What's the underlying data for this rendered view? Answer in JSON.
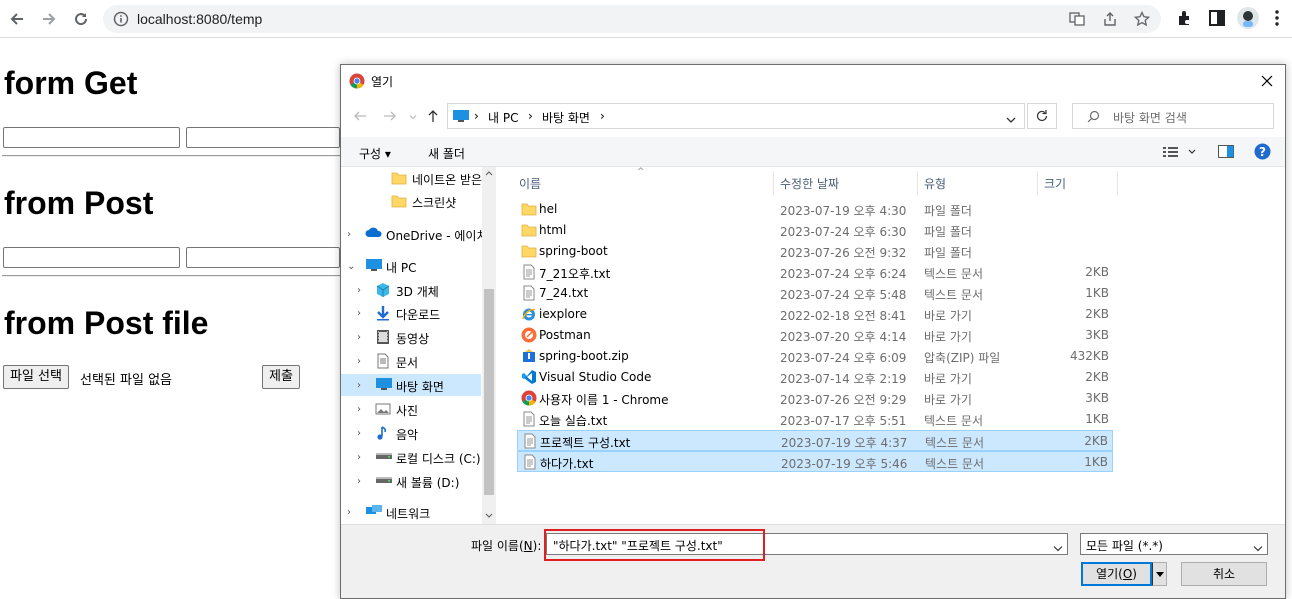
{
  "browser": {
    "url": "localhost:8080/temp"
  },
  "page": {
    "sections": [
      {
        "title": "form Get"
      },
      {
        "title": "from Post"
      },
      {
        "title": "from Post file"
      }
    ],
    "file_button": "파일 선택",
    "file_status": "선택된 파일 없음",
    "submit_button": "제출"
  },
  "dialog": {
    "title": "열기",
    "breadcrumb": [
      "내 PC",
      "바탕 화면"
    ],
    "search_placeholder": "바탕 화면 검색",
    "organize_label": "구성",
    "new_folder_label": "새 폴더",
    "nav_items": [
      {
        "label": "네이트온 받은 파",
        "icon": "folder-icon",
        "indent": 2
      },
      {
        "label": "스크린샷",
        "icon": "folder-icon",
        "indent": 2
      },
      {
        "label": "OneDrive - 에이치",
        "icon": "cloud-icon",
        "indent": 0
      },
      {
        "label": "내 PC",
        "icon": "pc-icon",
        "indent": 0
      },
      {
        "label": "3D 개체",
        "icon": "cube-icon",
        "indent": 1
      },
      {
        "label": "다운로드",
        "icon": "download-icon",
        "indent": 1
      },
      {
        "label": "동영상",
        "icon": "video-icon",
        "indent": 1
      },
      {
        "label": "문서",
        "icon": "document-icon",
        "indent": 1
      },
      {
        "label": "바탕 화면",
        "icon": "desktop-icon",
        "indent": 1
      },
      {
        "label": "사진",
        "icon": "picture-icon",
        "indent": 1
      },
      {
        "label": "음악",
        "icon": "music-icon",
        "indent": 1
      },
      {
        "label": "로컬 디스크 (C:)",
        "icon": "drive-icon",
        "indent": 1
      },
      {
        "label": "새 볼륨 (D:)",
        "icon": "drive-icon",
        "indent": 1
      },
      {
        "label": "네트워크",
        "icon": "network-icon",
        "indent": 0
      }
    ],
    "selected_nav": "바탕 화면",
    "columns": {
      "name": "이름",
      "date": "수정한 날짜",
      "type": "유형",
      "size": "크기"
    },
    "files": [
      {
        "name": "hel",
        "date": "2023-07-19 오후 4:30",
        "type": "파일 폴더",
        "size": "",
        "icon": "folder-icon",
        "selected": false
      },
      {
        "name": "html",
        "date": "2023-07-24 오후 6:30",
        "type": "파일 폴더",
        "size": "",
        "icon": "folder-icon",
        "selected": false
      },
      {
        "name": "spring-boot",
        "date": "2023-07-26 오전 9:32",
        "type": "파일 폴더",
        "size": "",
        "icon": "folder-icon",
        "selected": false
      },
      {
        "name": "7_21오후.txt",
        "date": "2023-07-24 오후 6:24",
        "type": "텍스트 문서",
        "size": "2KB",
        "icon": "text-file-icon",
        "selected": false
      },
      {
        "name": "7_24.txt",
        "date": "2023-07-24 오후 5:48",
        "type": "텍스트 문서",
        "size": "1KB",
        "icon": "text-file-icon",
        "selected": false
      },
      {
        "name": "iexplore",
        "date": "2022-02-18 오전 8:41",
        "type": "바로 가기",
        "size": "2KB",
        "icon": "ie-icon",
        "selected": false
      },
      {
        "name": "Postman",
        "date": "2023-07-20 오후 4:14",
        "type": "바로 가기",
        "size": "3KB",
        "icon": "postman-icon",
        "selected": false
      },
      {
        "name": "spring-boot.zip",
        "date": "2023-07-24 오후 6:09",
        "type": "압축(ZIP) 파일",
        "size": "432KB",
        "icon": "zip-icon",
        "selected": false
      },
      {
        "name": "Visual Studio Code",
        "date": "2023-07-14 오후 2:19",
        "type": "바로 가기",
        "size": "2KB",
        "icon": "vscode-icon",
        "selected": false
      },
      {
        "name": "사용자 이름 1 - Chrome",
        "date": "2023-07-26 오전 9:29",
        "type": "바로 가기",
        "size": "3KB",
        "icon": "chrome-icon",
        "selected": false
      },
      {
        "name": "오늘 실습.txt",
        "date": "2023-07-17 오후 5:51",
        "type": "텍스트 문서",
        "size": "1KB",
        "icon": "text-file-icon",
        "selected": false
      },
      {
        "name": "프로젝트 구성.txt",
        "date": "2023-07-19 오후 4:37",
        "type": "텍스트 문서",
        "size": "2KB",
        "icon": "text-file-icon",
        "selected": true
      },
      {
        "name": "하다가.txt",
        "date": "2023-07-19 오후 5:46",
        "type": "텍스트 문서",
        "size": "1KB",
        "icon": "text-file-icon",
        "selected": true
      }
    ],
    "filename_label_prefix": "파일 이름(",
    "filename_label_key": "N",
    "filename_label_suffix": "):",
    "filename_value": "\"하다가.txt\" \"프로젝트 구성.txt\"",
    "filetype_value": "모든 파일 (*.*)",
    "open_label_prefix": "열기(",
    "open_label_key": "O",
    "open_label_suffix": ")",
    "cancel_label": "취소",
    "highlight_color": "#e02020",
    "selection_color": "#cce8ff"
  }
}
